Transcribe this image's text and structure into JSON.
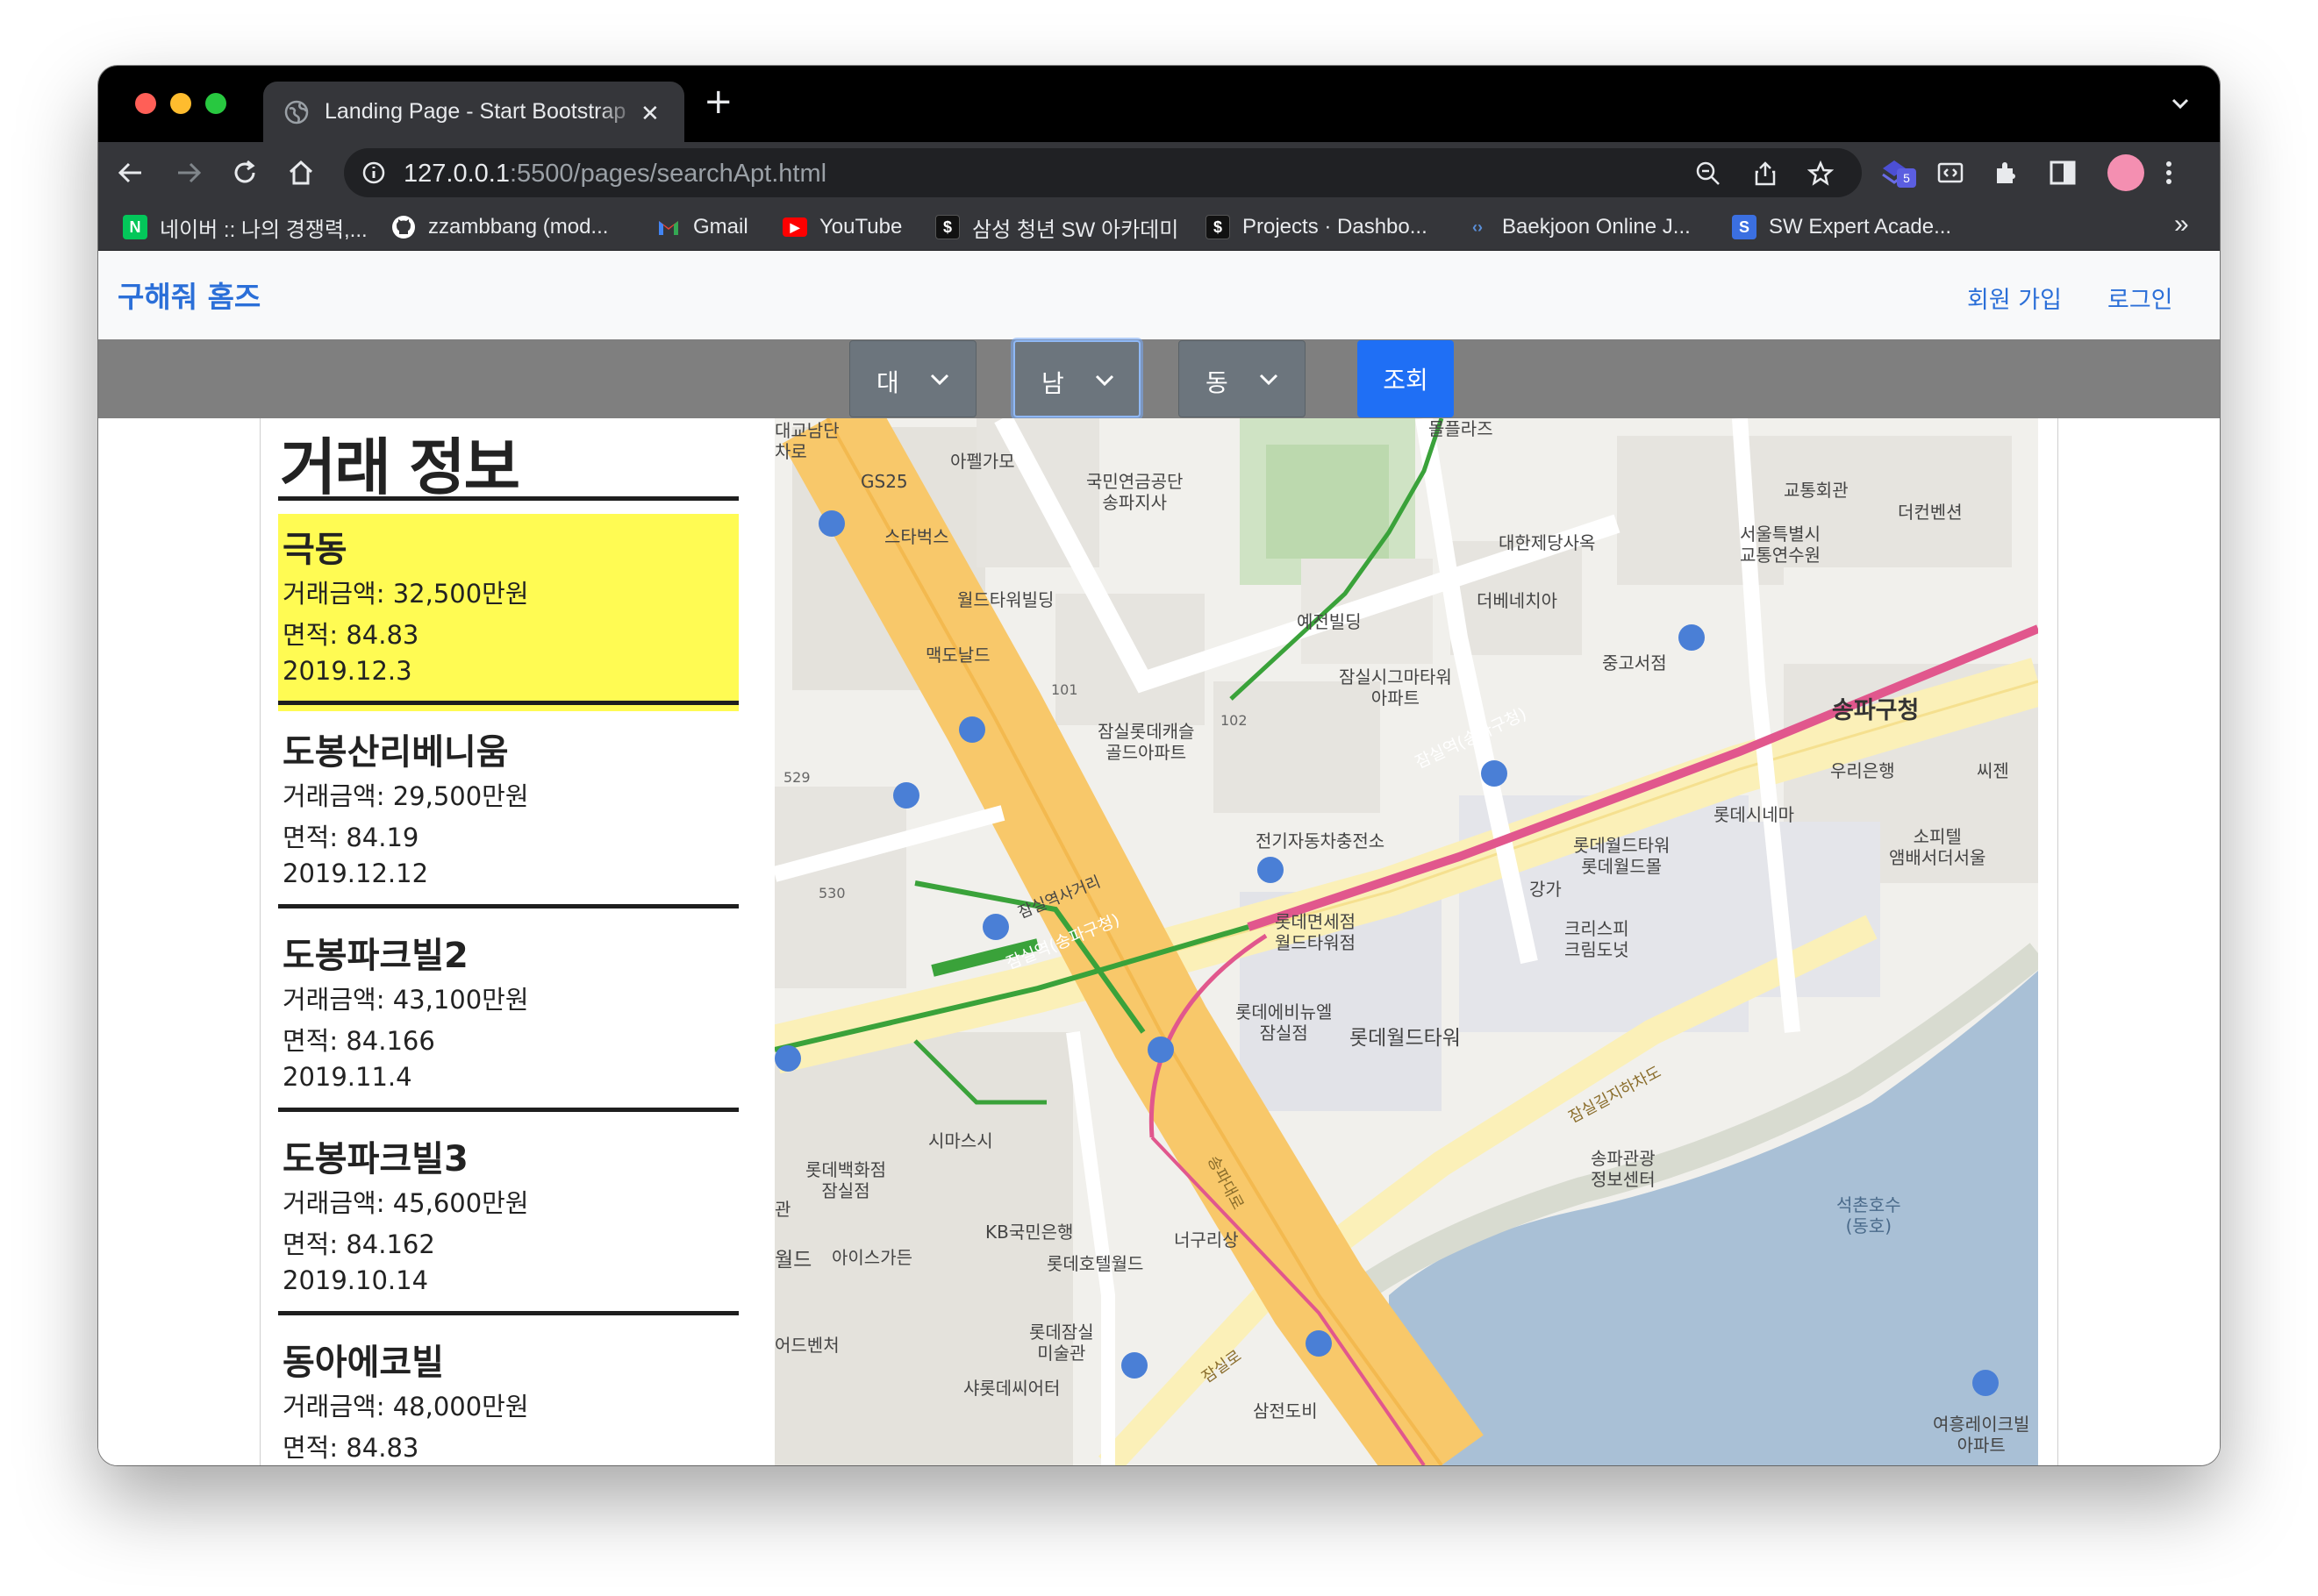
{
  "browser": {
    "tab_title": "Landing Page - Start Bootstrap",
    "url_host": "127.0.0.1",
    "url_rest": ":5500/pages/searchApt.html",
    "extension_badge": "5",
    "bookmarks": [
      {
        "label": "네이버 :: 나의 경쟁력,...",
        "icon": "naver-icon",
        "color": "#03c75a",
        "glyph": "N"
      },
      {
        "label": "zzambbang (mod...",
        "icon": "github-icon",
        "color": "#ffffff",
        "glyph": ""
      },
      {
        "label": "Gmail",
        "icon": "gmail-icon",
        "color": "#ea4335",
        "glyph": "M"
      },
      {
        "label": "YouTube",
        "icon": "youtube-icon",
        "color": "#ff0000",
        "glyph": "▶"
      },
      {
        "label": "삼성 청년 SW 아카데미",
        "icon": "ssafy-icon",
        "color": "#111111",
        "glyph": "$"
      },
      {
        "label": "Projects · Dashbo...",
        "icon": "gitlab-icon",
        "color": "#111111",
        "glyph": "$"
      },
      {
        "label": "Baekjoon Online J...",
        "icon": "code-icon",
        "color": "#35363a",
        "glyph": "‹›"
      },
      {
        "label": "SW Expert Acade...",
        "icon": "swea-icon",
        "color": "#3b6fe0",
        "glyph": "S"
      }
    ],
    "bookmarks_more": "»"
  },
  "navbar": {
    "brand": "구해줘 홈즈",
    "signup": "회원 가입",
    "login": "로그인"
  },
  "filters": {
    "city": "대",
    "district": "남",
    "dong": "동",
    "search_label": "조회"
  },
  "sidebar": {
    "title": "거래 정보",
    "items": [
      {
        "name": "극동",
        "price": "거래금액: 32,500만원",
        "area": "면적: 84.83",
        "date": "2019.12.3",
        "selected": true
      },
      {
        "name": "도봉산리베니움",
        "price": "거래금액: 29,500만원",
        "area": "면적: 84.19",
        "date": "2019.12.12",
        "selected": false
      },
      {
        "name": "도봉파크빌2",
        "price": "거래금액: 43,100만원",
        "area": "면적: 84.166",
        "date": "2019.11.4",
        "selected": false
      },
      {
        "name": "도봉파크빌3",
        "price": "거래금액: 45,600만원",
        "area": "면적: 84.162",
        "date": "2019.10.14",
        "selected": false
      },
      {
        "name": "동아에코빌",
        "price": "거래금액: 48,000만원",
        "area": "면적: 84.83",
        "date": "",
        "selected": false
      }
    ]
  },
  "map": {
    "labels": {
      "a1": "GS25",
      "a2": "아펠가모",
      "a3": "국민연금공단\n송파지사",
      "a4": "스타벅스",
      "a5": "월드타워빌딩",
      "a6": "맥도날드",
      "a7": "101",
      "a8": "잠실롯데캐슬\n골드아파트",
      "a9": "102",
      "a10": "529",
      "a11": "530",
      "a12": "교통회관",
      "a13": "더컨벤션",
      "a14": "서울특별시\n교통연수원",
      "a15": "대한제당사옥",
      "a16": "더베네치아",
      "a17": "예전빌딩",
      "a18": "잠실시그마타워\n아파트",
      "a19": "중고서점",
      "a20": "송파구청",
      "a21": "우리은행",
      "a22": "씨젠",
      "a23": "롯데시네마",
      "a24": "소피텔\n앰배서더서울",
      "a25": "전기자동차충전소",
      "a26": "롯데월드타워\n롯데월드몰",
      "a27": "강가",
      "a28": "크리스피\n크림도넛",
      "a29": "롯데면세점\n월드타워점",
      "a30": "롯데에비뉴엘\n잠실점",
      "a31": "롯데월드타워",
      "a32": "시마스시",
      "a33": "롯데백화점\n잠실점",
      "a34": "KB국민은행",
      "a35": "롯데호텔월드",
      "a36": "아이스가든",
      "a37": "너구리상",
      "a38": "롯데잠실\n미술관",
      "a39": "샤롯데씨어터",
      "a40": "삼전도비",
      "a41": "송파관광\n정보센터",
      "a42": "석촌호수\n(동호)",
      "a43": "여흥레이크빌\n아파트",
      "a44": "잠실길지하차도",
      "a45": "잠실역(송파구청)",
      "a46": "잠실역(송파구청)",
      "a47": "잠실로",
      "a48": "송파대로",
      "a49": "월드",
      "a50": "어드벤처",
      "a51": "관",
      "a52": "몰플라즈",
      "a53": "대교남단\n차로",
      "a54": "잠실역사거리"
    }
  }
}
